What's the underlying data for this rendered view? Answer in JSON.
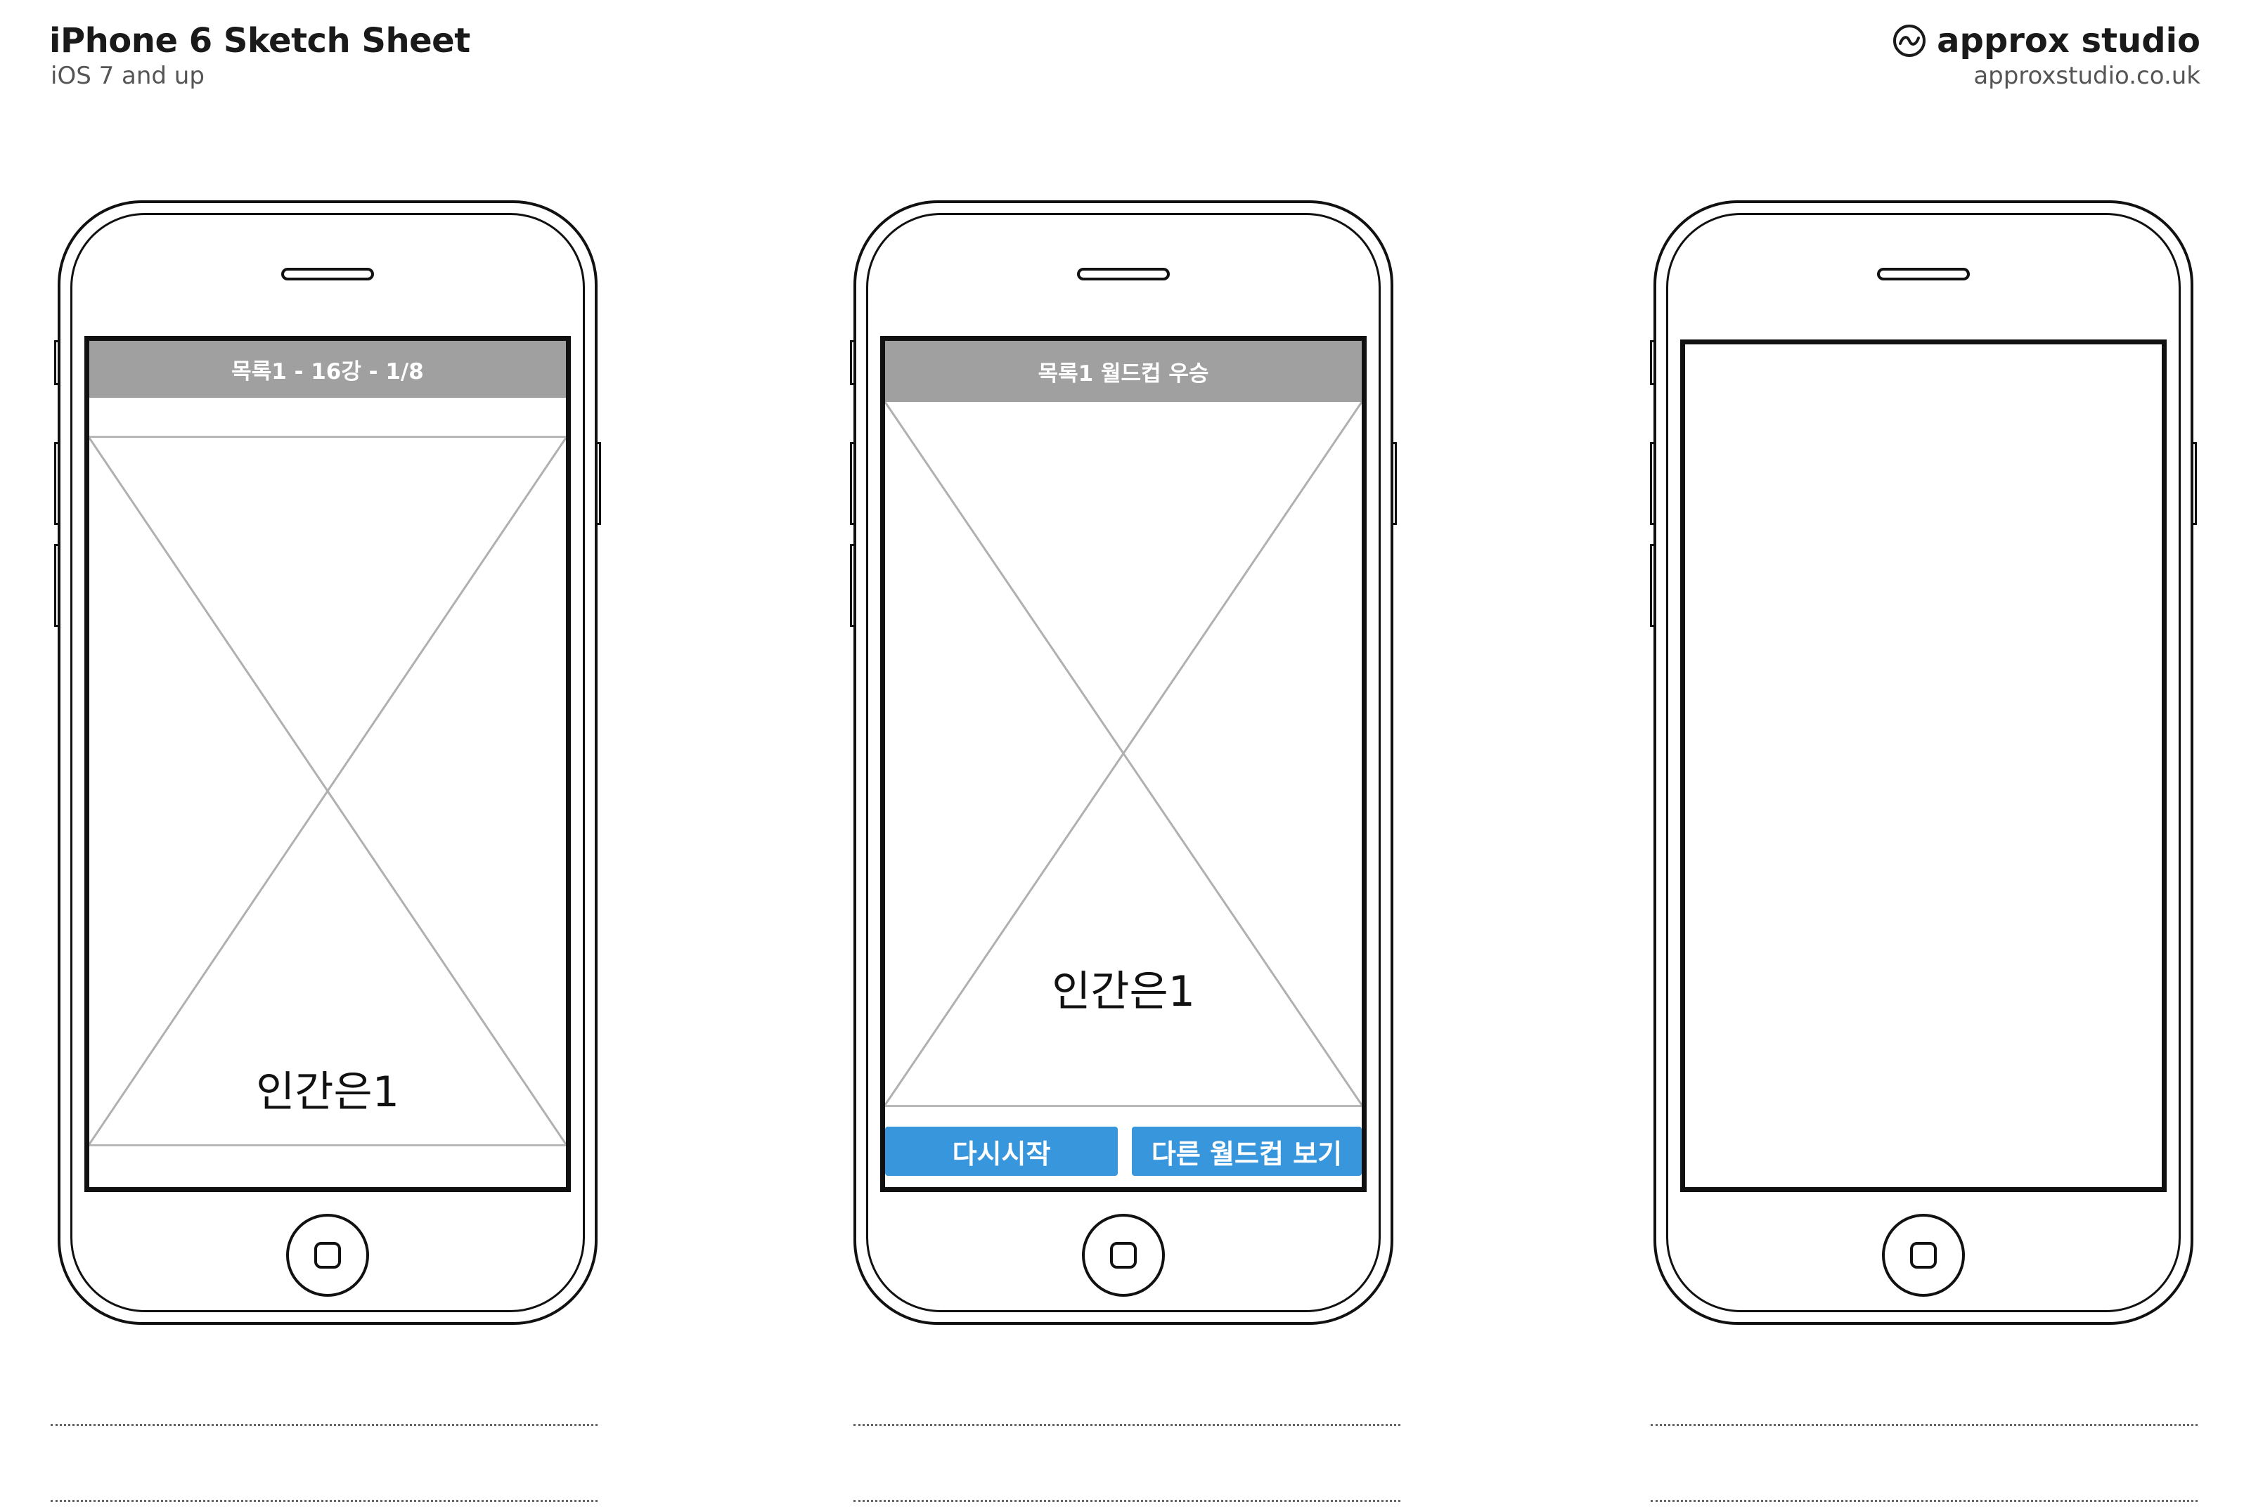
{
  "header": {
    "title": "iPhone 6 Sketch Sheet",
    "subtitle": "iOS 7 and up",
    "brand_name": "approx studio",
    "brand_url": "approxstudio.co.uk",
    "brand_icon": "wave-circle-icon"
  },
  "phones": [
    {
      "nav_title": "목록1 - 16강 - 1/8",
      "image_icon": "image-placeholder-icon",
      "caption": "인간은1"
    },
    {
      "nav_title": "목록1 월드컵 우승",
      "image_icon": "image-placeholder-icon",
      "caption": "인간은1",
      "buttons": [
        "다시시작",
        "다른 월드컵 보기"
      ]
    },
    {
      "blank": true
    }
  ],
  "colors": {
    "nav_bar": "#a0a0a0",
    "button": "#3896dd",
    "outline": "#111111"
  }
}
